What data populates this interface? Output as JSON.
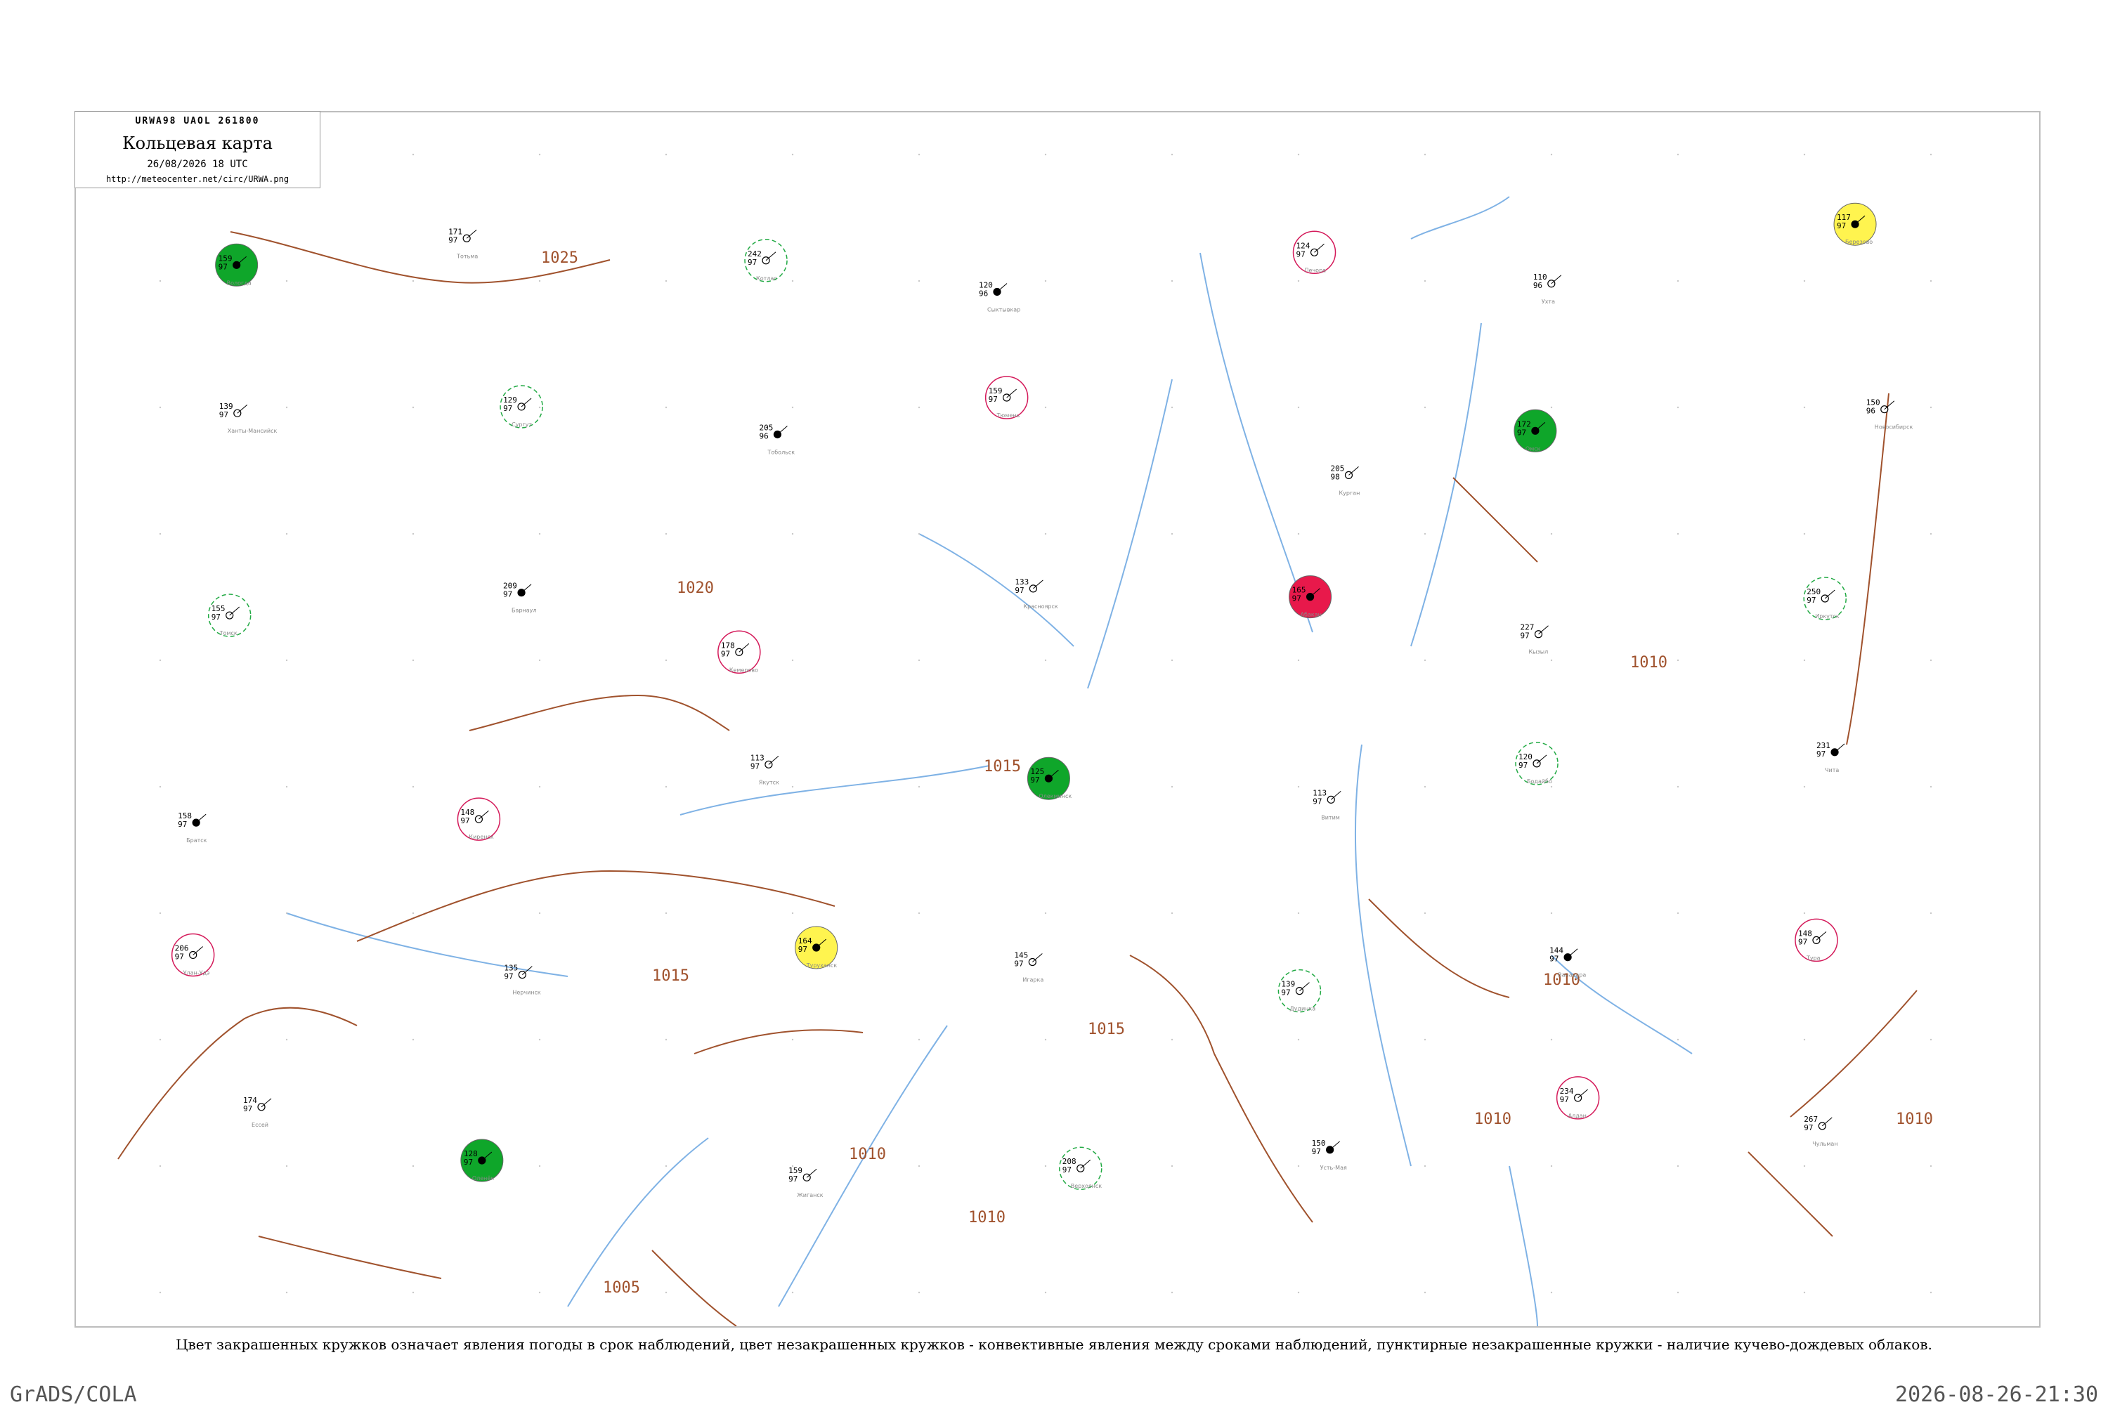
{
  "header": {
    "code": "URWA98 UAOL 261800",
    "title": "Кольцевая карта",
    "datetime": "26/08/2026 18 UTC",
    "url": "http://meteocenter.net/circ/URWA.png"
  },
  "caption": "Цвет закрашенных кружков означает явления погоды в срок наблюдений, цвет незакрашенных кружков - конвективные явления между сроками наблюдений, пунктирные незакрашенные кружки - наличие кучево-дождевых облаков.",
  "footer": {
    "left": "GrADS/COLA",
    "right": "2026-08-26-21:30"
  },
  "colors": {
    "isobar": "#a0522d",
    "river": "#7fb2e5",
    "rain_fill": "#0fa62a",
    "fog_fill": "#fff44f",
    "thunder_ring": "#d41a5a",
    "cb_ring": "#22aa44",
    "hot_fill": "#e8194b"
  },
  "isobar_labels": [
    "1025",
    "1020",
    "1015",
    "1015",
    "1015",
    "1010",
    "1010",
    "1010",
    "1010",
    "1010",
    "1010",
    "1005"
  ],
  "stations": [
    {
      "name": "Вологда",
      "p": "159",
      "t": "97"
    },
    {
      "name": "Тотьма",
      "p": "171",
      "t": "97"
    },
    {
      "name": "Котлас",
      "p": "242",
      "t": "97"
    },
    {
      "name": "Сыктывкар",
      "p": "120",
      "t": "96"
    },
    {
      "name": "Печора",
      "p": "124",
      "t": "97"
    },
    {
      "name": "Ухта",
      "p": "110",
      "t": "96"
    },
    {
      "name": "Березово",
      "p": "117",
      "t": "97"
    },
    {
      "name": "Ханты-Мансийск",
      "p": "139",
      "t": "97"
    },
    {
      "name": "Сургут",
      "p": "129",
      "t": "97"
    },
    {
      "name": "Тобольск",
      "p": "205",
      "t": "96"
    },
    {
      "name": "Тюмень",
      "p": "159",
      "t": "97"
    },
    {
      "name": "Курган",
      "p": "205",
      "t": "98"
    },
    {
      "name": "Омск",
      "p": "172",
      "t": "97"
    },
    {
      "name": "Новосибирск",
      "p": "150",
      "t": "96"
    },
    {
      "name": "Томск",
      "p": "155",
      "t": "97"
    },
    {
      "name": "Барнаул",
      "p": "209",
      "t": "97"
    },
    {
      "name": "Кемерово",
      "p": "178",
      "t": "97"
    },
    {
      "name": "Красноярск",
      "p": "133",
      "t": "97"
    },
    {
      "name": "Абакан",
      "p": "165",
      "t": "97"
    },
    {
      "name": "Кызыл",
      "p": "227",
      "t": "97"
    },
    {
      "name": "Иркутск",
      "p": "250",
      "t": "97"
    },
    {
      "name": "Братск",
      "p": "158",
      "t": "97"
    },
    {
      "name": "Киренск",
      "p": "148",
      "t": "97"
    },
    {
      "name": "Якутск",
      "p": "113",
      "t": "97"
    },
    {
      "name": "Олекминск",
      "p": "125",
      "t": "97"
    },
    {
      "name": "Витим",
      "p": "113",
      "t": "97"
    },
    {
      "name": "Бодайбо",
      "p": "120",
      "t": "97"
    },
    {
      "name": "Чита",
      "p": "231",
      "t": "97"
    },
    {
      "name": "Улан-Удэ",
      "p": "206",
      "t": "97"
    },
    {
      "name": "Нерчинск",
      "p": "135",
      "t": "97"
    },
    {
      "name": "Туруханск",
      "p": "164",
      "t": "97"
    },
    {
      "name": "Игарка",
      "p": "145",
      "t": "97"
    },
    {
      "name": "Дудинка",
      "p": "139",
      "t": "97"
    },
    {
      "name": "Ванавара",
      "p": "144",
      "t": "97"
    },
    {
      "name": "Тура",
      "p": "148",
      "t": "97"
    },
    {
      "name": "Ессей",
      "p": "174",
      "t": "97"
    },
    {
      "name": "Оленёк",
      "p": "128",
      "t": "97"
    },
    {
      "name": "Жиганск",
      "p": "159",
      "t": "97"
    },
    {
      "name": "Верхоянск",
      "p": "208",
      "t": "97"
    },
    {
      "name": "Усть-Мая",
      "p": "150",
      "t": "97"
    },
    {
      "name": "Алдан",
      "p": "234",
      "t": "97"
    },
    {
      "name": "Чульман",
      "p": "267",
      "t": "97"
    }
  ]
}
